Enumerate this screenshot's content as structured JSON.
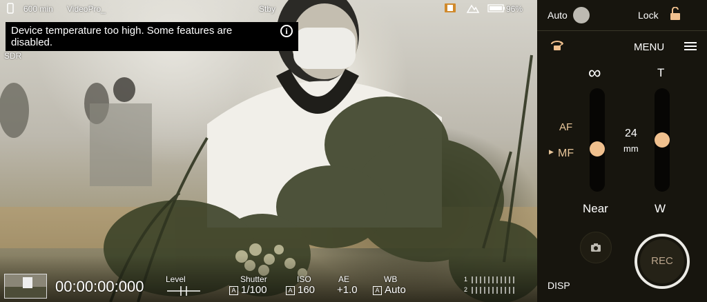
{
  "status": {
    "remaining": "600 min",
    "mode": "VideoPro_",
    "standby": "Stby",
    "battery": "96%"
  },
  "banner": {
    "text": "Device temperature too high. Some features are disabled.",
    "info_icon": "i"
  },
  "sdr_label": "SDR",
  "bottom_bar": {
    "timecode": "00:00:00:000",
    "level_label": "Level",
    "shutter_label": "Shutter",
    "shutter_value": "1/100",
    "iso_label": "ISO",
    "iso_value": "160",
    "af_label": "AE",
    "ae_value": "+1.0",
    "wb_label": "WB",
    "wb_value": "Auto",
    "auto_badge": "A",
    "meter_ch1": "1",
    "meter_ch2": "2"
  },
  "panel": {
    "auto_label": "Auto",
    "lock_label": "Lock",
    "menu_label": "MENU",
    "focus_far": "∞",
    "zoom_tele": "T",
    "af_label": "AF",
    "mf_label": "MF",
    "focal_value": "24",
    "focal_unit": "mm",
    "focus_near": "Near",
    "zoom_wide": "W",
    "disp_label": "DISP",
    "rec_label": "REC"
  },
  "colors": {
    "accent": "#f0c08e",
    "panel_bg": "#17150e",
    "label_gold": "#e9c79b"
  },
  "icons": [
    "phone-icon",
    "sd-card-icon",
    "scene-icon",
    "battery-icon",
    "info-icon",
    "lock-open-icon",
    "rotate-camera-icon",
    "hamburger-menu-icon",
    "camera-icon",
    "thumbnail"
  ]
}
